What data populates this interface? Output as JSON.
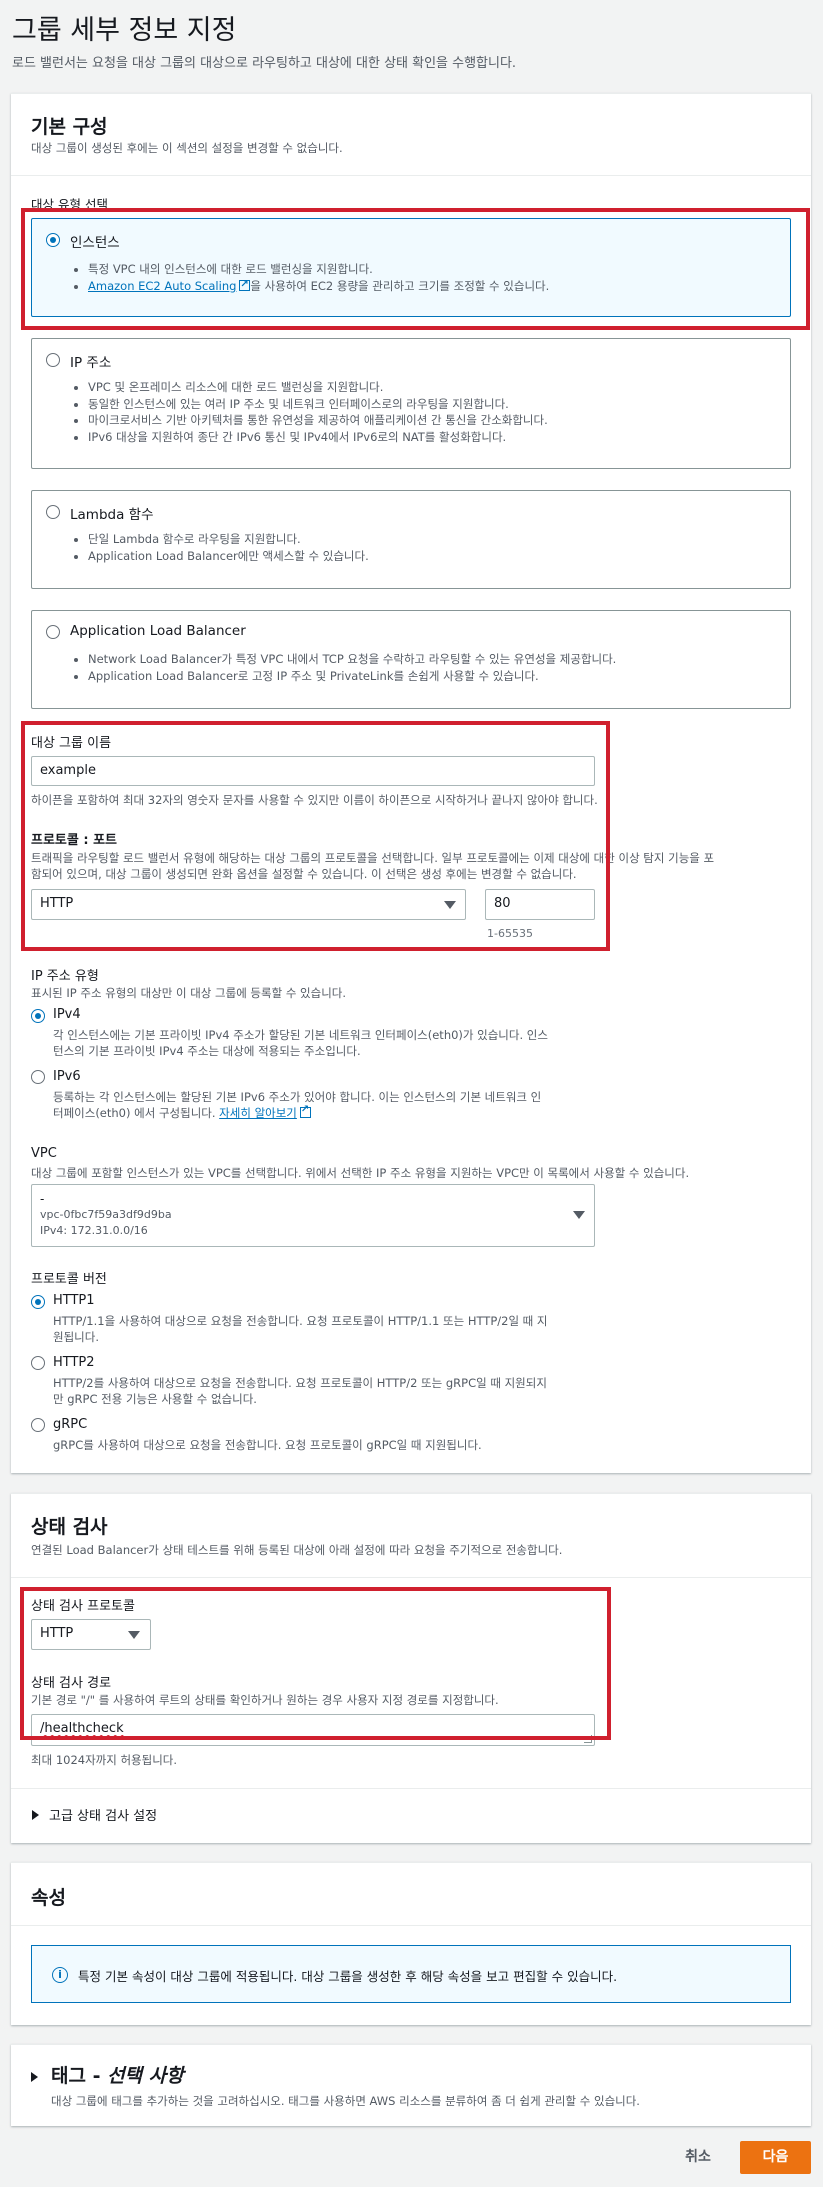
{
  "page": {
    "title": "그룹 세부 정보 지정",
    "description": "로드 밸런서는 요청을 대상 그룹의 대상으로 라우팅하고 대상에 대한 상태 확인을 수행합니다."
  },
  "basic": {
    "title": "기본 구성",
    "description": "대상 그룹이 생성된 후에는 이 섹션의 설정을 변경할 수 없습니다.",
    "target_type_label": "대상 유형 선택",
    "options": [
      {
        "label": "인스턴스",
        "selected": true,
        "bullets": [
          "특정 VPC 내의 인스턴스에 대한 로드 밸런싱을 지원합니다."
        ],
        "link_text": "Amazon EC2 Auto Scaling",
        "link_suffix": "을 사용하여 EC2 용량을 관리하고 크기를 조정할 수 있습니다."
      },
      {
        "label": "IP 주소",
        "selected": false,
        "bullets": [
          "VPC 및 온프레미스 리소스에 대한 로드 밸런싱을 지원합니다.",
          "동일한 인스턴스에 있는 여러 IP 주소 및 네트워크 인터페이스로의 라우팅을 지원합니다.",
          "마이크로서비스 기반 아키텍처를 통한 유연성을 제공하여 애플리케이션 간 통신을 간소화합니다.",
          "IPv6 대상을 지원하여 종단 간 IPv6 통신 및 IPv4에서 IPv6로의 NAT를 활성화합니다."
        ]
      },
      {
        "label": "Lambda 함수",
        "selected": false,
        "bullets": [
          "단일 Lambda 함수로 라우팅을 지원합니다.",
          "Application Load Balancer에만 액세스할 수 있습니다."
        ]
      },
      {
        "label": "Application Load Balancer",
        "selected": false,
        "bullets": [
          "Network Load Balancer가 특정 VPC 내에서 TCP 요청을 수락하고 라우팅할 수 있는 유연성을 제공합니다.",
          "Application Load Balancer로 고정 IP 주소 및 PrivateLink를 손쉽게 사용할 수 있습니다."
        ]
      }
    ],
    "target_group_name": {
      "label": "대상 그룹 이름",
      "value": "example",
      "hint": "하이픈을 포함하여 최대 32자의 영숫자 문자를 사용할 수 있지만 이름이 하이픈으로 시작하거나 끝나지 않아야 합니다."
    },
    "protocol_port": {
      "label": "프로토콜 : 포트",
      "description_line1": "트래픽을 라우팅할 로드 밸런서 유형에 해당하는 대상 그룹의 프로토콜을 선택합니다. 일부 프로토콜에는 이제 대상에 대한 이상 탐지 기능을 포",
      "description_line2": "함되어 있으며, 대상 그룹이 생성되면 완화 옵션을 설정할 수 있습니다. 이 선택은 생성 후에는 변경할 수 없습니다.",
      "protocol": "HTTP",
      "port": "80",
      "port_range": "1-65535"
    },
    "ip_type": {
      "label": "IP 주소 유형",
      "description": "표시된 IP 주소 유형의 대상만 이 대상 그룹에 등록할 수 있습니다.",
      "options": [
        {
          "label": "IPv4",
          "selected": true,
          "line1": "각 인스턴스에는 기본 프라이빗 IPv4 주소가 할당된 기본 네트워크 인터페이스(eth0)가 있습니다. 인스",
          "line2": "턴스의 기본 프라이빗 IPv4 주소는 대상에 적용되는 주소입니다."
        },
        {
          "label": "IPv6",
          "selected": false,
          "line1": "등록하는 각 인스턴스에는 할당된 기본 IPv6 주소가 있어야 합니다. 이는 인스턴스의 기본 네트워크 인",
          "line2": "터페이스(eth0) 에서 구성됩니다.",
          "link_text": "자세히 알아보기"
        }
      ]
    },
    "vpc": {
      "label": "VPC",
      "description": "대상 그룹에 포함할 인스턴스가 있는 VPC를 선택합니다. 위에서 선택한 IP 주소 유형을 지원하는 VPC만 이 목록에서 사용할 수 있습니다.",
      "name": "-",
      "id": "vpc-0fbc7f59a3df9d9ba",
      "cidr": "IPv4: 172.31.0.0/16"
    },
    "protocol_version": {
      "label": "프로토콜 버전",
      "options": [
        {
          "label": "HTTP1",
          "selected": true,
          "line1": "HTTP/1.1을 사용하여 대상으로 요청을 전송합니다. 요청 프로토콜이 HTTP/1.1 또는 HTTP/2일 때 지",
          "line2": "원됩니다."
        },
        {
          "label": "HTTP2",
          "selected": false,
          "line1": "HTTP/2를 사용하여 대상으로 요청을 전송합니다. 요청 프로토콜이 HTTP/2 또는 gRPC일 때 지원되지",
          "line2": "만 gRPC 전용 기능은 사용할 수 없습니다."
        },
        {
          "label": "gRPC",
          "selected": false,
          "line1": "gRPC를 사용하여 대상으로 요청을 전송합니다. 요청 프로토콜이 gRPC일 때 지원됩니다.",
          "line2": ""
        }
      ]
    }
  },
  "health": {
    "title": "상태 검사",
    "description": "연결된 Load Balancer가 상태 테스트를 위해 등록된 대상에 아래 설정에 따라 요청을 주기적으로 전송합니다.",
    "protocol_label": "상태 검사 프로토콜",
    "protocol": "HTTP",
    "path_label": "상태 검사 경로",
    "path_description": "기본 경로 \"/\" 를 사용하여 루트의 상태를 확인하거나 원하는 경우 사용자 지정 경로를 지정합니다.",
    "path_value": "/healthcheck",
    "path_hint": "최대 1024자까지 허용됩니다.",
    "advanced": "고급 상태 검사 설정"
  },
  "attributes": {
    "title": "속성",
    "info": "특정 기본 속성이 대상 그룹에 적용됩니다. 대상 그룹을 생성한 후 해당 속성을 보고 편집할 수 있습니다."
  },
  "tags": {
    "title": "태그 - ",
    "title_optional": "선택 사항",
    "description": "대상 그룹에 태그를 추가하는 것을 고려하십시오. 태그를 사용하면 AWS 리소스를 분류하여 좀 더 쉽게 관리할 수 있습니다."
  },
  "footer": {
    "cancel": "취소",
    "next": "다음"
  },
  "colors": {
    "accent": "#0073bb",
    "primary_button": "#ec7211",
    "highlight": "#d0202e"
  }
}
